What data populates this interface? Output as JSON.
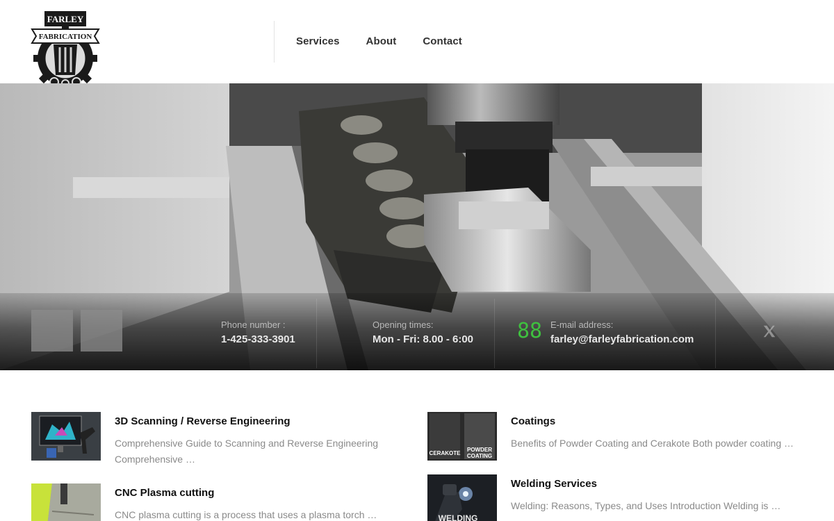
{
  "brand": {
    "logo_top_text": "FARLEY",
    "logo_banner_text": "FABRICATION"
  },
  "nav": {
    "items": [
      "Services",
      "About",
      "Contact"
    ]
  },
  "contact_bar": {
    "phone_label": "Phone number :",
    "phone_value": "1-425-333-3901",
    "hours_label": "Opening times:",
    "hours_value": "Mon - Fri: 8.00 - 6:00",
    "email_label": "E-mail address:",
    "email_value": "farley@farleyfabrication.com",
    "icon_digits": "88",
    "accent_green": "#3fbf3f"
  },
  "services": [
    {
      "title": "3D Scanning / Reverse Engineering",
      "desc_line1": "Comprehensive Guide to Scanning and Reverse Engineering",
      "desc_line2": "Comprehensive …"
    },
    {
      "title": "Coatings",
      "desc_line1": "Benefits of Powder Coating and Cerakote Both powder coating …",
      "thumb_left": "CERAKOTE",
      "thumb_right_1": "POWDER",
      "thumb_right_2": "COATING"
    },
    {
      "title": "CNC Plasma cutting",
      "desc_line1": "CNC plasma cutting is a process that uses a plasma torch …"
    },
    {
      "title": "Welding Services",
      "desc_line1": "Welding: Reasons, Types, and Uses Introduction Welding is …",
      "thumb_text": "WELDING"
    }
  ]
}
